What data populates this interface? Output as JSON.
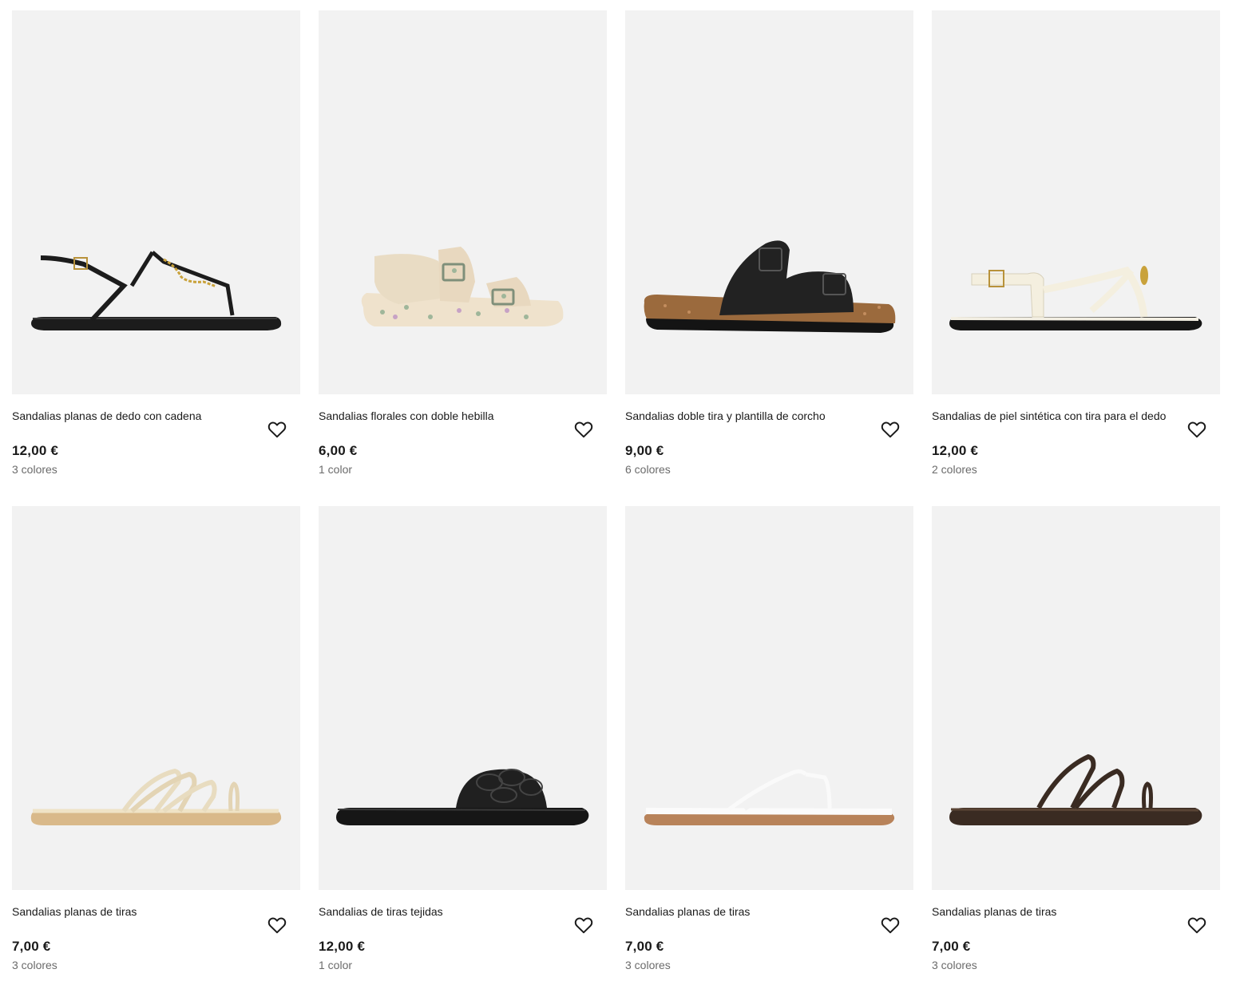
{
  "products": [
    {
      "name": "Sandalias planas de dedo con cadena",
      "price": "12,00 €",
      "colors": "3 colores",
      "image_icon": "black-thong-sandal-chain"
    },
    {
      "name": "Sandalias florales con doble hebilla",
      "price": "6,00 €",
      "colors": "1 color",
      "image_icon": "floral-double-buckle-sandal"
    },
    {
      "name": "Sandalias doble tira y plantilla de corcho",
      "price": "9,00 €",
      "colors": "6 colores",
      "image_icon": "black-cork-double-strap-sandal"
    },
    {
      "name": "Sandalias de piel sintética con tira para el dedo",
      "price": "12,00 €",
      "colors": "2 colores",
      "image_icon": "cream-toe-strap-sandal"
    },
    {
      "name": "Sandalias planas de tiras",
      "price": "7,00 €",
      "colors": "3 colores",
      "image_icon": "gold-strappy-flat-sandal"
    },
    {
      "name": "Sandalias de tiras tejidas",
      "price": "12,00 €",
      "colors": "1 color",
      "image_icon": "black-woven-strap-slide"
    },
    {
      "name": "Sandalias planas de tiras",
      "price": "7,00 €",
      "colors": "3 colores",
      "image_icon": "white-strappy-flat-sandal"
    },
    {
      "name": "Sandalias planas de tiras",
      "price": "7,00 €",
      "colors": "3 colores",
      "image_icon": "brown-strappy-flat-sandal"
    }
  ],
  "colors": {
    "image_bg": "#f2f2f2",
    "text": "#1a1a1a",
    "muted": "#6b6b6b"
  }
}
